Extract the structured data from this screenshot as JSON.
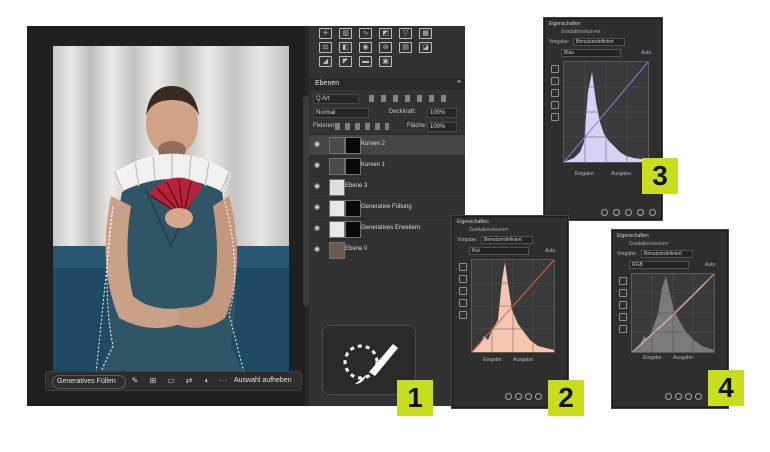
{
  "layers_panel": {
    "tab": "Ebenen",
    "filter": "Q Art",
    "blend_mode": "Normal",
    "opacity_label": "Deckkraft:",
    "opacity_value": "100%",
    "lock_label": "Fixieren:",
    "fill_label": "Fläche:",
    "fill_value": "100%",
    "layers": [
      {
        "name": "Kurven 2"
      },
      {
        "name": "Kurven 1"
      },
      {
        "name": "Ebene 3"
      },
      {
        "name": "Generative Füllung"
      },
      {
        "name": "Generatives Erweitern"
      },
      {
        "name": "Ebene 0"
      }
    ]
  },
  "taskbar": {
    "generative_fill": "Generatives Füllen",
    "deselect": "Auswahl aufheben",
    "more": "···"
  },
  "properties": {
    "title": "Eigenschaften",
    "subtitle": "Gradationskurven",
    "preset_label": "Vorgabe:",
    "preset_value": "Benutzerdefiniert",
    "input_label": "Eingabe:",
    "output_label": "Ausgabe:",
    "auto_label": "Auto"
  },
  "panels": [
    {
      "channel": "Blau",
      "histogram_color": "#d8d0f5",
      "curve_color": "#8a7ee0"
    },
    {
      "channel": "Rot",
      "histogram_color": "#f6c6b0",
      "curve_color": "#e06050"
    },
    {
      "channel": "RGB",
      "histogram_color": "#7a7a7a",
      "curve_color": "#cfcfcf"
    }
  ],
  "callouts": {
    "one": "1",
    "two": "2",
    "three": "3",
    "four": "4"
  }
}
